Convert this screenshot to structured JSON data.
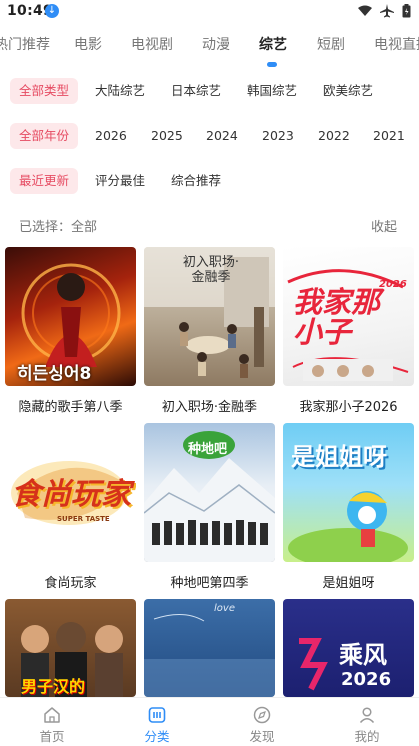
{
  "status_bar": {
    "time": "10:49"
  },
  "tabs": [
    {
      "label": "热门推荐"
    },
    {
      "label": "电影"
    },
    {
      "label": "电视剧"
    },
    {
      "label": "动漫"
    },
    {
      "label": "综艺",
      "active": true
    },
    {
      "label": "短剧"
    },
    {
      "label": "电视直播"
    }
  ],
  "filters": {
    "type": [
      "全部类型",
      "大陆综艺",
      "日本综艺",
      "韩国综艺",
      "欧美综艺"
    ],
    "year": [
      "全部年份",
      "2026",
      "2025",
      "2024",
      "2023",
      "2022",
      "2021"
    ],
    "sort": [
      "最近更新",
      "评分最佳",
      "综合推荐"
    ]
  },
  "selected": {
    "label": "已选择：全部",
    "collapse": "收起"
  },
  "items": [
    {
      "title": "隐藏的歌手第八季",
      "poster_text": "히든싱어8"
    },
    {
      "title": "初入职场·金融季",
      "poster_text": "初入职场·金融季"
    },
    {
      "title": "我家那小子2026",
      "poster_text": "我家那小子",
      "poster_year": "2026"
    },
    {
      "title": "食尚玩家",
      "poster_text": "食尚玩家",
      "poster_sub": "SUPER TASTE"
    },
    {
      "title": "种地吧第四季",
      "poster_text": "种地吧"
    },
    {
      "title": "是姐姐呀",
      "poster_text": "是姐姐呀"
    },
    {
      "title": "",
      "poster_text": "男子汉的"
    },
    {
      "title": "",
      "poster_text": "love"
    },
    {
      "title": "",
      "poster_text": "乘风",
      "poster_year": "2026"
    }
  ],
  "bottom_nav": [
    {
      "label": "首页",
      "icon": "home-icon"
    },
    {
      "label": "分类",
      "icon": "category-icon",
      "active": true
    },
    {
      "label": "发现",
      "icon": "discover-icon"
    },
    {
      "label": "我的",
      "icon": "profile-icon"
    }
  ],
  "colors": {
    "accent": "#2f8df6",
    "chip_active_bg": "#fde8ea",
    "chip_active_text": "#e64b62"
  }
}
